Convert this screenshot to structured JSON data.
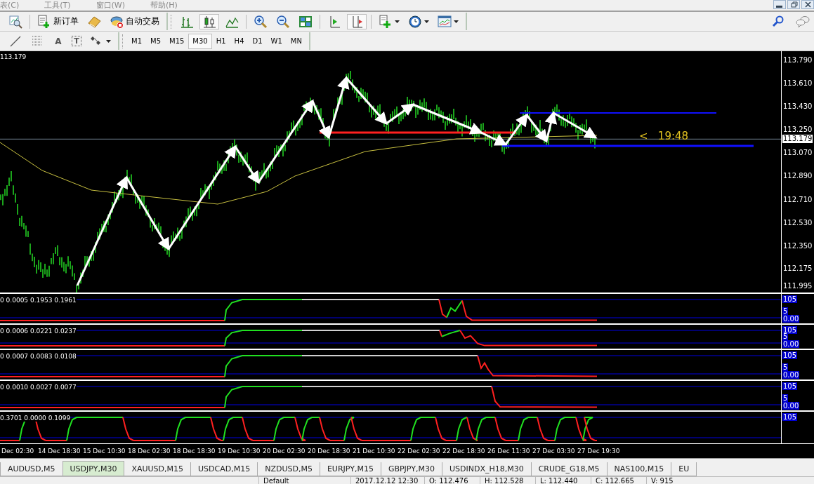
{
  "menu_bar": {
    "items": [
      "表(C)",
      "工具(T)",
      "窗口(W)",
      "帮助(H)"
    ]
  },
  "toolbar": {
    "new_order": "新订单",
    "auto_trading": "自动交易",
    "chart_mode": [
      {
        "kind": "bars",
        "selected": false
      },
      {
        "kind": "candles",
        "selected": true
      },
      {
        "kind": "line",
        "selected": false
      }
    ],
    "autoscroll": true
  },
  "drawing_tools": {
    "text_tool": "A",
    "label_tool": "T"
  },
  "timeframes": [
    {
      "label": "M1",
      "selected": false
    },
    {
      "label": "M5",
      "selected": false
    },
    {
      "label": "M15",
      "selected": false
    },
    {
      "label": "M30",
      "selected": true
    },
    {
      "label": "H1",
      "selected": false
    },
    {
      "label": "H4",
      "selected": false
    },
    {
      "label": "D1",
      "selected": false
    },
    {
      "label": "W1",
      "selected": false
    },
    {
      "label": "MN",
      "selected": false
    }
  ],
  "chart": {
    "price_label": "113.179",
    "countdown": "<   19:48",
    "current_price": "113.179",
    "price_axis": [
      "113.790",
      "113.610",
      "113.430",
      "113.250",
      "113.070",
      "112.890",
      "112.710",
      "112.530",
      "112.350",
      "112.175",
      "111.995"
    ],
    "time_axis": [
      "Dec 02:30",
      "14 Dec 18:30",
      "15 Dec 10:30",
      "18 Dec 02:30",
      "18 Dec 18:30",
      "19 Dec 10:30",
      "20 Dec 02:30",
      "20 Dec 18:30",
      "21 Dec 10:30",
      "22 Dec 02:30",
      "22 Dec 18:30",
      "26 Dec 11:30",
      "27 Dec 03:30",
      "27 Dec 19:30"
    ]
  },
  "indicators": [
    {
      "values": "0 0.0005 0.1953 0.1961",
      "levels": [
        "105",
        "5",
        "0.00"
      ]
    },
    {
      "values": "0 0.0006 0.0221 0.0237",
      "levels": [
        "105",
        "5",
        "0.00"
      ]
    },
    {
      "values": "0 0.0007 0.0083 0.0108",
      "levels": [
        "105",
        "5",
        "0.00"
      ]
    },
    {
      "values": "0 0.0010 0.0027 0.0077",
      "levels": [
        "105",
        "5",
        "0.00"
      ]
    },
    {
      "values": "0.3701 0.0000 0.1099",
      "levels": [
        "105"
      ]
    }
  ],
  "symbol_tabs": [
    {
      "label": "AUDUSD,M5",
      "selected": false
    },
    {
      "label": "USDJPY,M30",
      "selected": true
    },
    {
      "label": "XAUUSD,M15",
      "selected": false
    },
    {
      "label": "USDCAD,M15",
      "selected": false
    },
    {
      "label": "NZDUSD,M5",
      "selected": false
    },
    {
      "label": "EURJPY,M15",
      "selected": false
    },
    {
      "label": "GBPJPY,M30",
      "selected": false
    },
    {
      "label": "USDINDX_H18,M30",
      "selected": false
    },
    {
      "label": "CRUDE_G18,M5",
      "selected": false
    },
    {
      "label": "NAS100,M15",
      "selected": false
    },
    {
      "label": "EU",
      "selected": false
    }
  ],
  "status_bar": [
    "Default",
    "2017.12.12 12:30",
    "O: 112.476",
    "H: 112.528",
    "L: 112.440",
    "C: 112.665",
    "V: 915"
  ]
}
